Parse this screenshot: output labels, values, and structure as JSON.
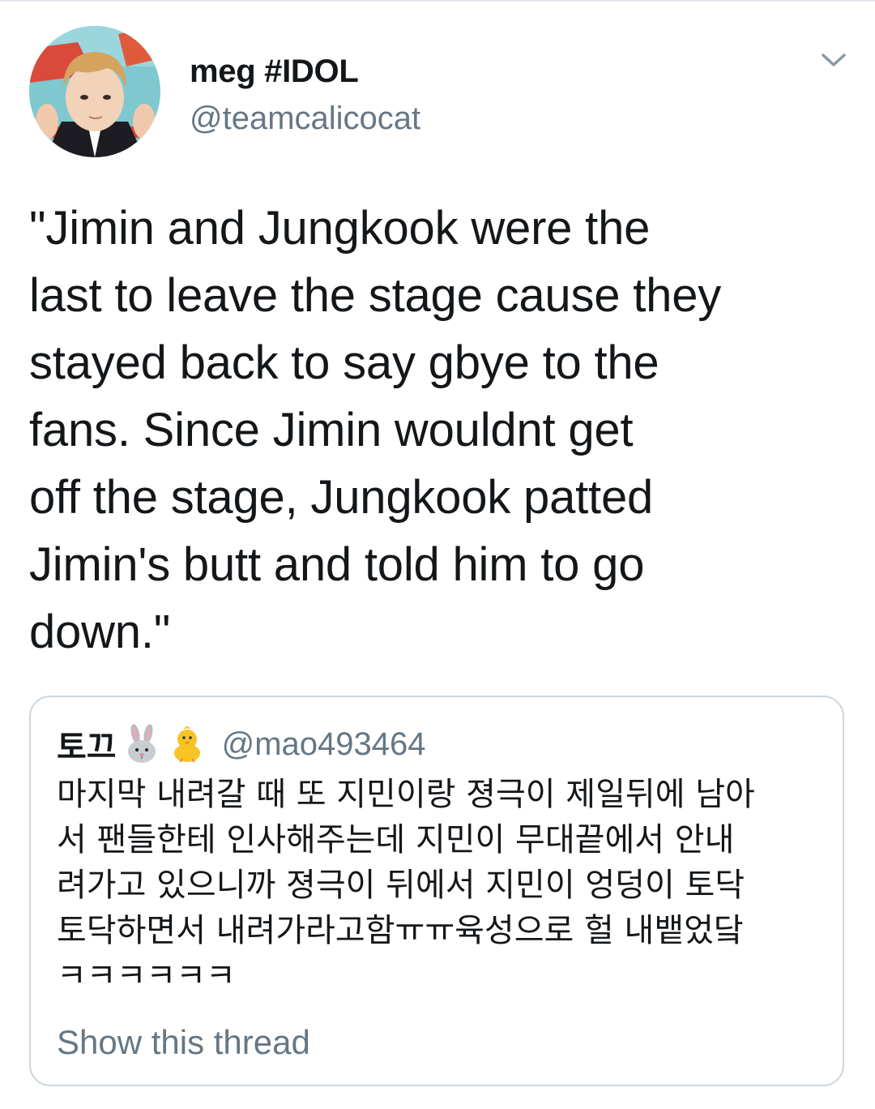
{
  "tweet": {
    "author": {
      "display_name": "meg #IDOL",
      "handle": "@teamcalicocat",
      "avatar_icon": "profile-photo"
    },
    "menu_icon": "chevron-down-icon",
    "text_lines": [
      "\"Jimin and Jungkook were the",
      "last to leave the stage cause they",
      "stayed back to say gbye to the",
      "fans. Since Jimin wouldnt get",
      "off the stage, Jungkook patted",
      "Jimin's butt and told him to go",
      "down.\""
    ]
  },
  "quote": {
    "display_name": "토끄",
    "emojis": [
      "rabbit-face-icon",
      "baby-chick-icon"
    ],
    "handle": "@mao493464",
    "text_lines": [
      "마지막 내려갈 때 또 지민이랑 졍극이 제일뒤에 남아",
      "서 팬들한테 인사해주는데 지민이 무대끝에서 안내",
      "려가고 있으니까 졍극이 뒤에서 지민이 엉덩이 토닥",
      "토닥하면서 내려가라고함ㅠㅠ육성으로 헐 내뱉었닼",
      "ㅋㅋㅋㅋㅋㅋ"
    ],
    "show_thread_label": "Show this thread"
  },
  "colors": {
    "text_primary": "#14171a",
    "text_secondary": "#657786",
    "border": "#ccd6dd"
  }
}
